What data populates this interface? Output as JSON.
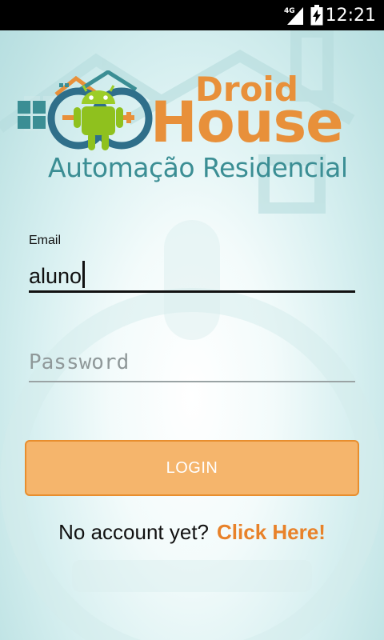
{
  "status_bar": {
    "network_type": "4G",
    "time": "12:21",
    "signal_icon": "signal-icon",
    "battery_icon": "battery-charging-icon"
  },
  "logo": {
    "title_top": "Droid",
    "title_main": "House",
    "subtitle": "Automação Residencial",
    "mascot_icon": "android-robot-icon",
    "brand_color": "#e8903a",
    "subtitle_color": "#3b8e94"
  },
  "form": {
    "email_label": "Email",
    "email_value": "aluno",
    "password_placeholder": "Password",
    "login_label": "LOGIN",
    "login_color": "#f5b56c"
  },
  "signup": {
    "prompt": "No account yet?",
    "link": "Click Here!",
    "link_color": "#e8822a"
  }
}
